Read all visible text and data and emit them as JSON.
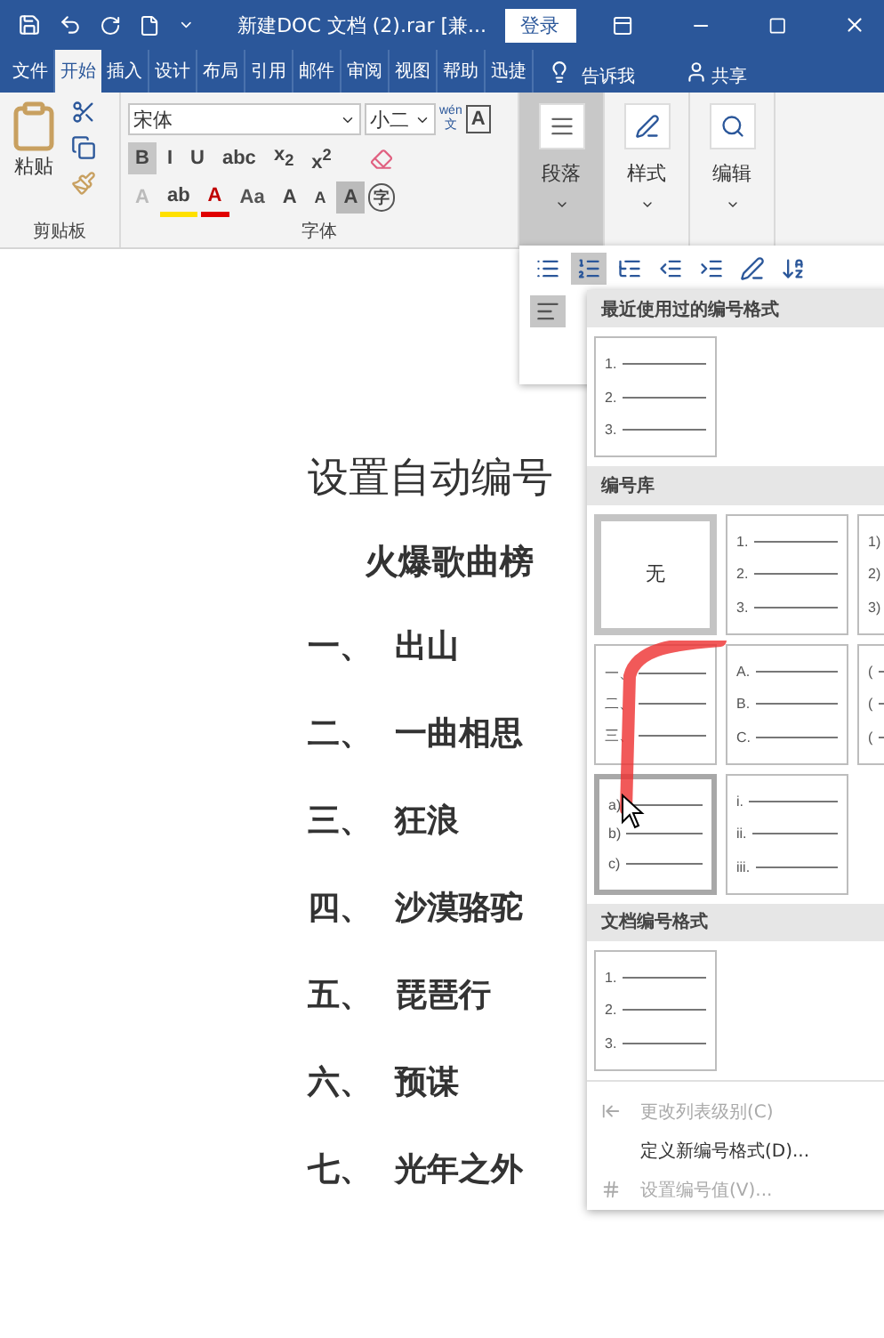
{
  "title_bar": {
    "title": "新建DOC 文档 (2).rar [兼...",
    "login": "登录"
  },
  "tabs": [
    {
      "label": "文件",
      "selected": false
    },
    {
      "label": "开始",
      "selected": true
    },
    {
      "label": "插入",
      "selected": false
    },
    {
      "label": "设计",
      "selected": false
    },
    {
      "label": "布局",
      "selected": false
    },
    {
      "label": "引用",
      "selected": false
    },
    {
      "label": "邮件",
      "selected": false
    },
    {
      "label": "审阅",
      "selected": false
    },
    {
      "label": "视图",
      "selected": false
    },
    {
      "label": "帮助",
      "selected": false
    },
    {
      "label": "迅捷",
      "selected": false
    }
  ],
  "tell_me": "告诉我",
  "share": "共享",
  "clipboard": {
    "paste": "粘贴",
    "label": "剪贴板"
  },
  "font": {
    "name": "宋体",
    "size": "小二",
    "phonetic_top": "wén",
    "phonetic_char": "文",
    "border_char": "A",
    "label": "字体",
    "row2": [
      {
        "label": "B",
        "pressed": true
      },
      {
        "label": "I",
        "pressed": false
      },
      {
        "label": "U",
        "pressed": false
      },
      {
        "label": "abc",
        "pressed": false
      },
      {
        "label": "x$_{2}$",
        "pressed": false
      },
      {
        "label": "x$^{2}$",
        "pressed": false
      }
    ],
    "row3": [
      {
        "label": "A",
        "kind": "effect"
      },
      {
        "label": "ab",
        "kind": "highlight"
      },
      {
        "label": "A",
        "kind": "color"
      },
      {
        "label": "Aa",
        "kind": "case"
      },
      {
        "label": "A",
        "kind": "grow"
      },
      {
        "label": "A",
        "kind": "shrink"
      },
      {
        "label": "A",
        "kind": "shade"
      },
      {
        "label": "字",
        "kind": "enclose"
      }
    ]
  },
  "ribbon_groups": [
    {
      "label": "段落",
      "pressed": true
    },
    {
      "label": "样式",
      "pressed": false
    },
    {
      "label": "编辑",
      "pressed": false
    }
  ],
  "paragraph_toolbar": {
    "buttons": [
      {
        "kind": "bullets",
        "selected": false
      },
      {
        "kind": "numbering",
        "selected": true
      },
      {
        "kind": "multilevel",
        "selected": false
      },
      {
        "kind": "outdent",
        "selected": false
      },
      {
        "kind": "indent",
        "selected": false
      },
      {
        "kind": "layout",
        "selected": false
      },
      {
        "kind": "sort",
        "selected": false
      }
    ],
    "align": [
      {
        "kind": "left",
        "selected": true
      }
    ]
  },
  "document": {
    "title": "设置自动编号",
    "subtitle": "火爆歌曲榜",
    "items": [
      {
        "number": "一、",
        "text": "出山"
      },
      {
        "number": "二、",
        "text": "一曲相思"
      },
      {
        "number": "三、",
        "text": "狂浪"
      },
      {
        "number": "四、",
        "text": "沙漠骆驼"
      },
      {
        "number": "五、",
        "text": "琵琶行"
      },
      {
        "number": "六、",
        "text": "预谋"
      },
      {
        "number": "七、",
        "text": "光年之外"
      }
    ]
  },
  "numbering_menu": {
    "sections": [
      {
        "title": "最近使用过的编号格式",
        "tiles": [
          {
            "kind": "list",
            "labels": [
              "1.",
              "2.",
              "3."
            ],
            "selected": false,
            "hovered": false
          }
        ]
      },
      {
        "title": "编号库",
        "tiles": [
          {
            "kind": "none",
            "labels": [
              "无"
            ],
            "selected": true,
            "hovered": false
          },
          {
            "kind": "list",
            "labels": [
              "1.",
              "2.",
              "3."
            ],
            "selected": false,
            "hovered": false
          },
          {
            "kind": "list",
            "labels": [
              "1)",
              "2)",
              "3)"
            ],
            "selected": false,
            "hovered": false
          },
          {
            "kind": "list",
            "labels": [
              "一、",
              "二、",
              "三、"
            ],
            "selected": false,
            "hovered": false
          },
          {
            "kind": "list",
            "labels": [
              "A.",
              "B.",
              "C."
            ],
            "selected": false,
            "hovered": false
          },
          {
            "kind": "list",
            "labels": [
              "(",
              "(",
              "("
            ],
            "selected": false,
            "hovered": false
          },
          {
            "kind": "list",
            "labels": [
              "a)",
              "b)",
              "c)"
            ],
            "selected": false,
            "hovered": true
          },
          {
            "kind": "list",
            "labels": [
              "i.",
              "ii.",
              "iii."
            ],
            "selected": false,
            "hovered": false
          }
        ]
      },
      {
        "title": "文档编号格式",
        "tiles": [
          {
            "kind": "list",
            "labels": [
              "1.",
              "2.",
              "3."
            ],
            "selected": false,
            "hovered": false
          }
        ]
      }
    ],
    "commands": [
      {
        "label": "更改列表级别(C)",
        "disabled": true,
        "kind": "level"
      },
      {
        "label": "定义新编号格式(D)...",
        "disabled": false,
        "kind": "define"
      },
      {
        "label": "设置编号值(V)...",
        "disabled": true,
        "kind": "value"
      }
    ]
  }
}
